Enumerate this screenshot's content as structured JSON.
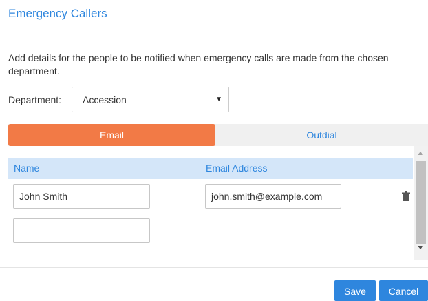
{
  "dialog": {
    "title": "Emergency Callers",
    "description": "Add details for the people to be notified when emergency calls are made from the chosen department."
  },
  "department": {
    "label": "Department:",
    "selected": "Accession"
  },
  "tabs": [
    {
      "label": "Email",
      "active": true
    },
    {
      "label": "Outdial",
      "active": false
    }
  ],
  "table": {
    "columns": [
      "Name",
      "Email Address"
    ],
    "rows": [
      {
        "name": "John Smith",
        "email": "john.smith@example.com"
      },
      {
        "name": "",
        "email": ""
      }
    ]
  },
  "buttons": {
    "save": "Save",
    "cancel": "Cancel"
  },
  "colors": {
    "accent": "#2e86de",
    "active_tab": "#f27a46",
    "header_row": "#d4e6f9"
  }
}
